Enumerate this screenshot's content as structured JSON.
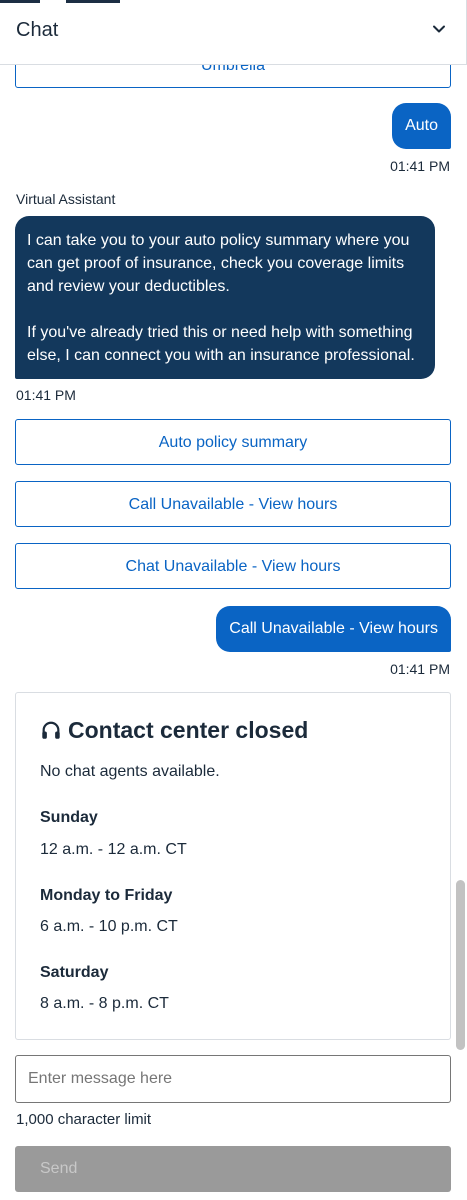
{
  "header": {
    "title": "Chat"
  },
  "messages": {
    "umbrella_option": "Umbrella",
    "user_auto": {
      "text": "Auto",
      "time": "01:41 PM"
    },
    "bot": {
      "sender": "Virtual Assistant",
      "paragraph_1": "I can take you to your auto policy summary where you can get proof of insurance, check you coverage limits and review your deductibles.",
      "paragraph_2": "If you've already tried this or need help with something else, I can connect you with an insurance professional.",
      "time": "01:41 PM"
    },
    "options": [
      "Auto policy summary",
      "Call Unavailable - View hours",
      "Chat Unavailable - View hours"
    ],
    "user_call": {
      "text": "Call Unavailable - View hours",
      "time": "01:41 PM"
    }
  },
  "contact_card": {
    "title": "Contact center closed",
    "subtitle": "No chat agents available.",
    "hours": [
      {
        "day": "Sunday",
        "time": "12 a.m. - 12 a.m. CT"
      },
      {
        "day": "Monday to Friday",
        "time": "6 a.m. - 10 p.m. CT"
      },
      {
        "day": "Saturday",
        "time": "8 a.m. - 8 p.m. CT"
      }
    ]
  },
  "composer": {
    "placeholder": "Enter message here",
    "char_limit": "1,000 character limit",
    "send_label": "Send"
  },
  "icons": {
    "collapse": "chevron-down-icon",
    "contact": "headset-icon"
  },
  "colors": {
    "accent": "#0a64c4",
    "bot_bubble": "#13385c",
    "send_disabled": "#9a9a9a"
  }
}
